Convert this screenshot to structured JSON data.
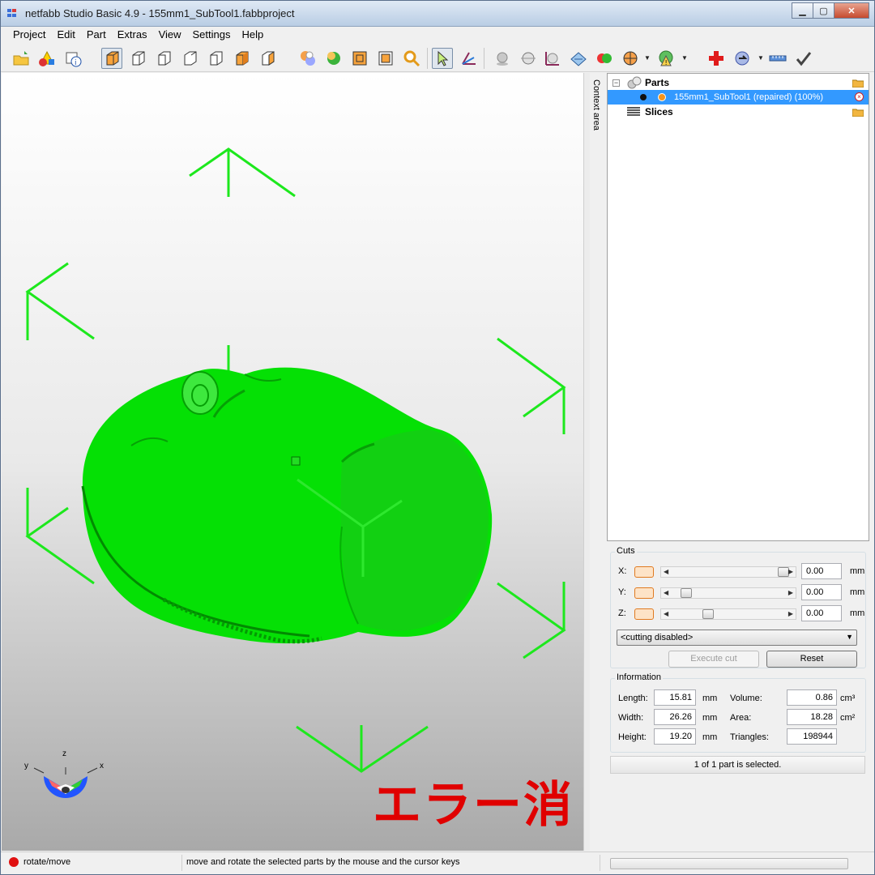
{
  "window": {
    "title": "netfabb Studio Basic 4.9 - 155mm1_SubTool1.fabbproject"
  },
  "menu": [
    "Project",
    "Edit",
    "Part",
    "Extras",
    "View",
    "Settings",
    "Help"
  ],
  "toolbar": {
    "icons": [
      "open-project-icon",
      "add-part-icon",
      "part-info-icon",
      "view-3d-icon",
      "view-front-icon",
      "view-back-icon",
      "view-left-icon",
      "view-right-icon",
      "view-top-icon",
      "view-bottom-icon",
      "shading-icon",
      "solid-shading-icon",
      "wireframe-icon",
      "bounding-box-icon",
      "zoom-icon",
      "select-cursor-icon",
      "move-axis-icon",
      "sphere-icon",
      "sphere-outline-icon",
      "scale-icon",
      "lattice-icon",
      "boolean-icon",
      "section-icon",
      "warning-analysis-icon",
      "repair-icon",
      "rotate-part-icon",
      "measure-icon",
      "confirm-icon"
    ]
  },
  "viewport": {
    "overlay_text": "エラー消",
    "axis_labels": {
      "x": "x",
      "y": "y",
      "z": "z"
    }
  },
  "context_tab": "Context area",
  "tree": {
    "parts_label": "Parts",
    "part_item": "155mm1_SubTool1 (repaired) (100%)",
    "slices_label": "Slices"
  },
  "cuts": {
    "title": "Cuts",
    "axes": [
      {
        "label": "X:",
        "value": "0.00",
        "unit": "mm",
        "position": 0.97
      },
      {
        "label": "Y:",
        "value": "0.00",
        "unit": "mm",
        "position": 0.09
      },
      {
        "label": "Z:",
        "value": "0.00",
        "unit": "mm",
        "position": 0.29
      }
    ],
    "dropdown_value": "<cutting disabled>",
    "execute_label": "Execute cut",
    "reset_label": "Reset"
  },
  "information": {
    "title": "Information",
    "length_label": "Length:",
    "length_value": "15.81",
    "length_unit": "mm",
    "width_label": "Width:",
    "width_value": "26.26",
    "width_unit": "mm",
    "height_label": "Height:",
    "height_value": "19.20",
    "height_unit": "mm",
    "volume_label": "Volume:",
    "volume_value": "0.86",
    "volume_unit": "cm³",
    "area_label": "Area:",
    "area_value": "18.28",
    "area_unit": "cm²",
    "triangles_label": "Triangles:",
    "triangles_value": "198944"
  },
  "selection_status": "1 of 1 part is selected.",
  "statusbar": {
    "mode": "rotate/move",
    "hint": "move and rotate the selected parts by the mouse and the cursor keys"
  },
  "colors": {
    "model": "#00e000",
    "frame": "#1de81d",
    "selection": "#3399ff",
    "overlay": "#e00000"
  }
}
